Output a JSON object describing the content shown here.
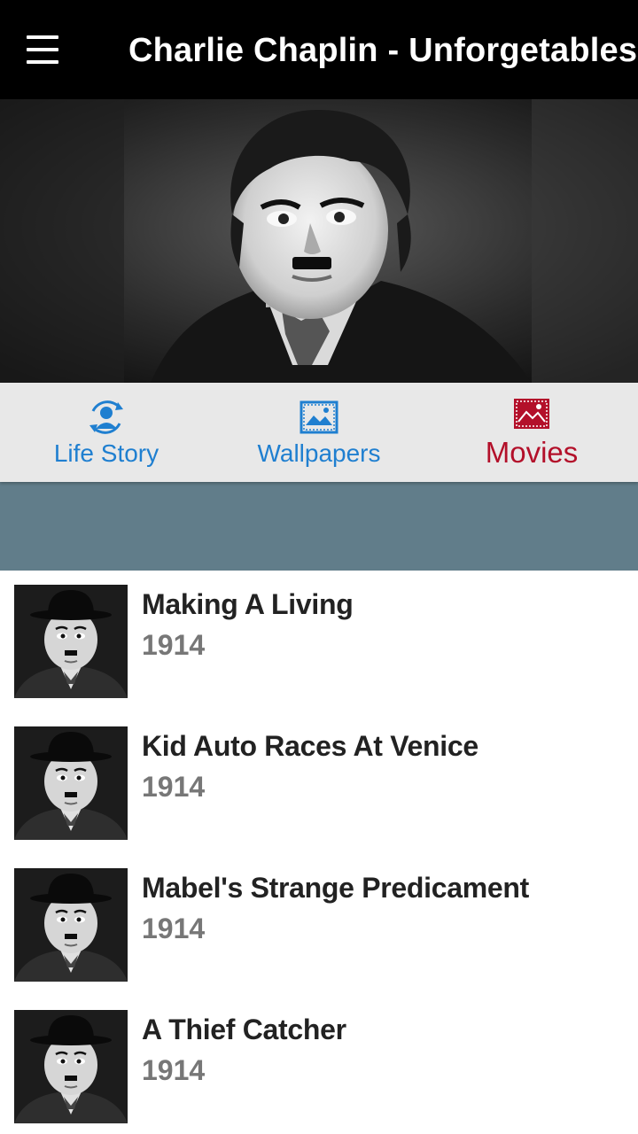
{
  "app_bar": {
    "title": "Charlie Chaplin - Unforgetables",
    "menu_icon": "hamburger-menu-icon"
  },
  "tabs": [
    {
      "label": "Life Story",
      "icon": "person-sync-icon",
      "active": false
    },
    {
      "label": "Wallpapers",
      "icon": "image-icon",
      "active": false
    },
    {
      "label": "Movies",
      "icon": "image-icon",
      "active": true
    }
  ],
  "movies": [
    {
      "title": "Making A Living",
      "year": "1914"
    },
    {
      "title": "Kid Auto Races At Venice",
      "year": "1914"
    },
    {
      "title": "Mabel's Strange Predicament",
      "year": "1914"
    },
    {
      "title": "A Thief Catcher",
      "year": "1914"
    }
  ],
  "colors": {
    "app_bar": "#000000",
    "tab_bar": "#e8e8e8",
    "tab_inactive": "#1f7fd0",
    "tab_active": "#b3102a",
    "band": "#617d8a",
    "movie_title": "#222222",
    "movie_year": "#777777"
  }
}
